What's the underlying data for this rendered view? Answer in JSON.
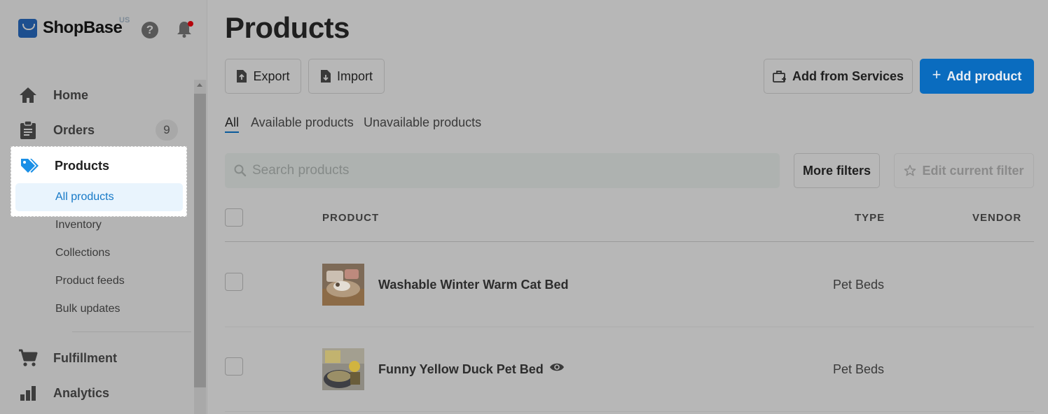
{
  "brand": {
    "name": "ShopBase",
    "region": "US"
  },
  "header_icons": {
    "help": "help-icon",
    "notifications": "bell-icon",
    "notification_dot_color": "#b5030b"
  },
  "sidebar": {
    "items": [
      {
        "label": "Home",
        "icon": "home-icon"
      },
      {
        "label": "Orders",
        "icon": "clipboard-icon",
        "badge": "9"
      },
      {
        "label": "Products",
        "icon": "tag-icon",
        "active": true
      },
      {
        "label": "Fulfillment",
        "icon": "cart-icon"
      },
      {
        "label": "Analytics",
        "icon": "bar-chart-icon"
      }
    ],
    "product_subitems": [
      "All products",
      "Inventory",
      "Collections",
      "Product feeds",
      "Bulk updates"
    ]
  },
  "page": {
    "title": "Products"
  },
  "toolbar": {
    "export_label": "Export",
    "import_label": "Import",
    "add_from_services_label": "Add from Services",
    "add_product_label": "Add product",
    "accent_color": "#0a6cbf"
  },
  "tabs": [
    "All",
    "Available products",
    "Unavailable products"
  ],
  "search": {
    "placeholder": "Search products"
  },
  "filters": {
    "more_filters_label": "More filters",
    "edit_filter_label": "Edit current filter"
  },
  "table": {
    "headers": {
      "product": "PRODUCT",
      "type": "TYPE",
      "vendor": "VENDOR"
    },
    "rows": [
      {
        "name": "Washable Winter Warm Cat Bed",
        "type": "Pet Beds",
        "vendor": ""
      },
      {
        "name": "Funny Yellow Duck Pet Bed",
        "type": "Pet Beds",
        "vendor": "",
        "preview_icon": "eye-icon"
      }
    ]
  }
}
